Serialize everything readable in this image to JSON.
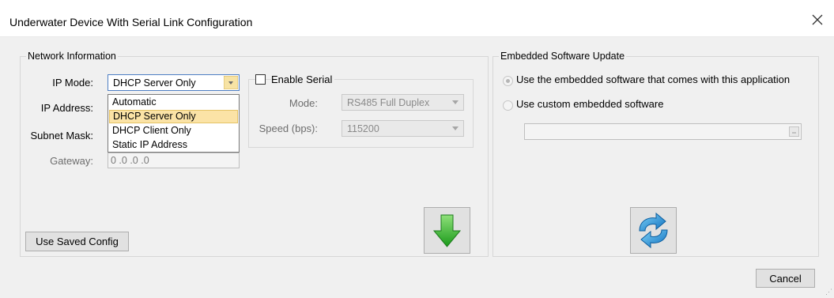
{
  "window": {
    "title": "Underwater Device With Serial Link Configuration"
  },
  "network": {
    "legend": "Network Information",
    "ip_mode_label": "IP Mode:",
    "ip_mode_value": "DHCP Server Only",
    "ip_mode_options": [
      "Automatic",
      "DHCP Server Only",
      "DHCP Client Only",
      "Static IP Address"
    ],
    "ip_address_label": "IP Address:",
    "subnet_mask_label": "Subnet Mask:",
    "gateway_label": "Gateway:",
    "gateway_value": "0 .0 .0 .0",
    "use_saved_config": "Use Saved Config"
  },
  "serial": {
    "enable_label": "Enable Serial",
    "enabled": false,
    "mode_label": "Mode:",
    "mode_value": "RS485 Full Duplex",
    "speed_label": "Speed (bps):",
    "speed_value": "115200"
  },
  "embedded": {
    "legend": "Embedded Software Update",
    "option_default": "Use the embedded software that comes with this application",
    "option_custom": "Use custom embedded software",
    "path_value": ""
  },
  "footer": {
    "cancel": "Cancel"
  },
  "colors": {
    "selection_bg": "#fbe3a6",
    "download_arrow": "#2eb52e",
    "update_arrows": "#1e8fd6"
  },
  "icons": {
    "close": "close-icon",
    "download": "download-arrow-icon",
    "update": "refresh-arrows-icon"
  }
}
